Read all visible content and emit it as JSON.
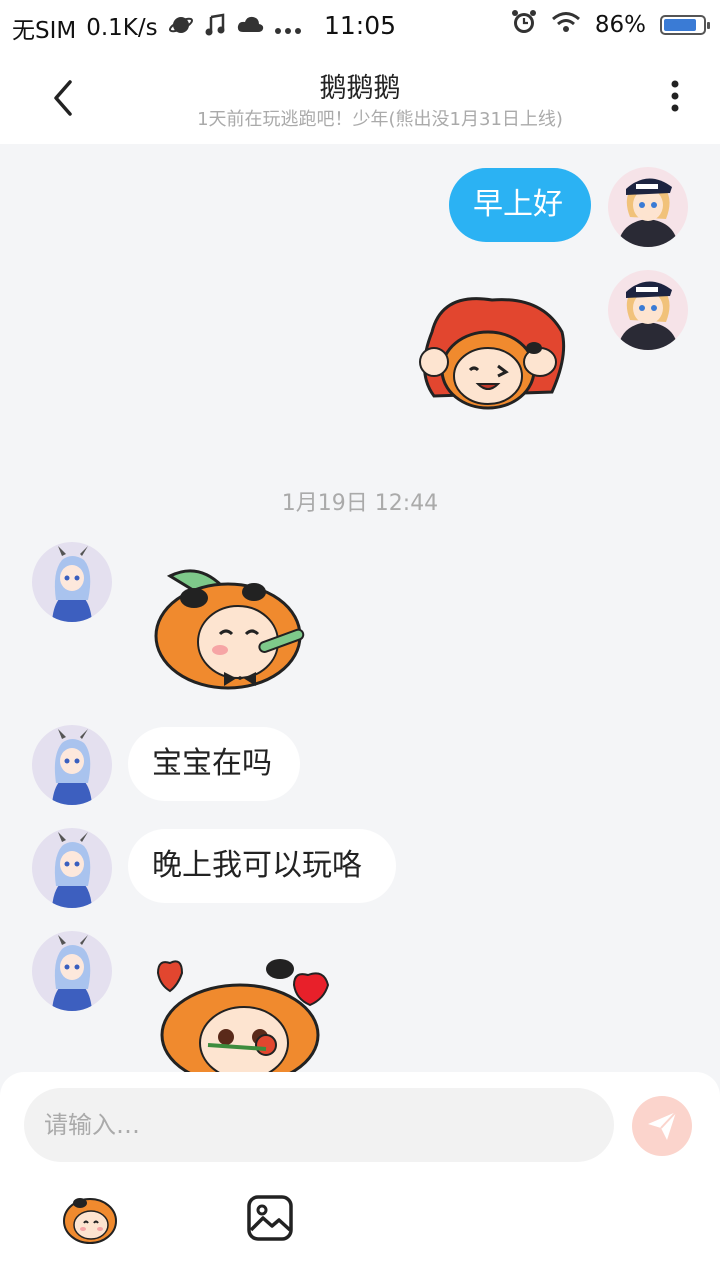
{
  "status_bar": {
    "carrier": "无SIM",
    "speed": "0.1K/s",
    "time": "11:05",
    "battery": "86%",
    "battery_level": 0.86
  },
  "header": {
    "title": "鹅鹅鹅",
    "subtitle": "1天前在玩逃跑吧！少年(熊出没1月31日上线)"
  },
  "messages": {
    "me_1": "早上好",
    "timestamp": "1月19日 12:44",
    "them_1": "宝宝在吗",
    "them_2": "晚上我可以玩咯"
  },
  "input": {
    "placeholder": "请输入…"
  },
  "colors": {
    "my_bubble": "#2bb2f3",
    "send_button": "#fbd4cc",
    "accent_orange": "#f07a2a"
  }
}
